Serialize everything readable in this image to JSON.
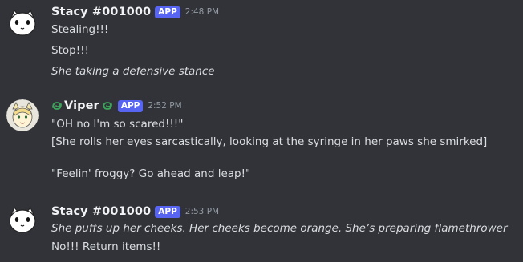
{
  "messages": [
    {
      "author": "Stacy #001000",
      "tag": "APP",
      "time": "2:48 PM",
      "avatar_icon": "white-cat-avatar-icon",
      "lines": [
        {
          "text": "Stealing!!!",
          "italic": false
        },
        {
          "text": "Stop!!!",
          "italic": false
        },
        {
          "text": "She taking a defensive stance",
          "italic": true
        }
      ]
    },
    {
      "author": "Viper",
      "tag": "APP",
      "time": "2:52 PM",
      "avatar_icon": "anime-character-avatar-icon",
      "name_icons": [
        "viper-logo-icon",
        "viper-logo-icon"
      ],
      "lines": [
        {
          "text": "\"OH no I'm so scared!!!\"",
          "italic": false
        },
        {
          "text": "[She rolls her eyes sarcastically, looking at the syringe in her paws she smirked]",
          "italic": false
        },
        {
          "text": "",
          "italic": false
        },
        {
          "text": "\"Feelin' froggy? Go ahead and leap!\"",
          "italic": false
        }
      ]
    },
    {
      "author": "Stacy #001000",
      "tag": "APP",
      "time": "2:53 PM",
      "avatar_icon": "white-cat-avatar-icon",
      "lines": [
        {
          "text": "She puffs up her cheeks. Her cheeks become orange. She’s preparing flamethrower",
          "italic": true
        },
        {
          "text": "No!!! Return items!!",
          "italic": false
        }
      ]
    }
  ],
  "colors": {
    "background": "#313338",
    "app_tag": "#5865f2",
    "viper_icon": "#3ba55c"
  }
}
